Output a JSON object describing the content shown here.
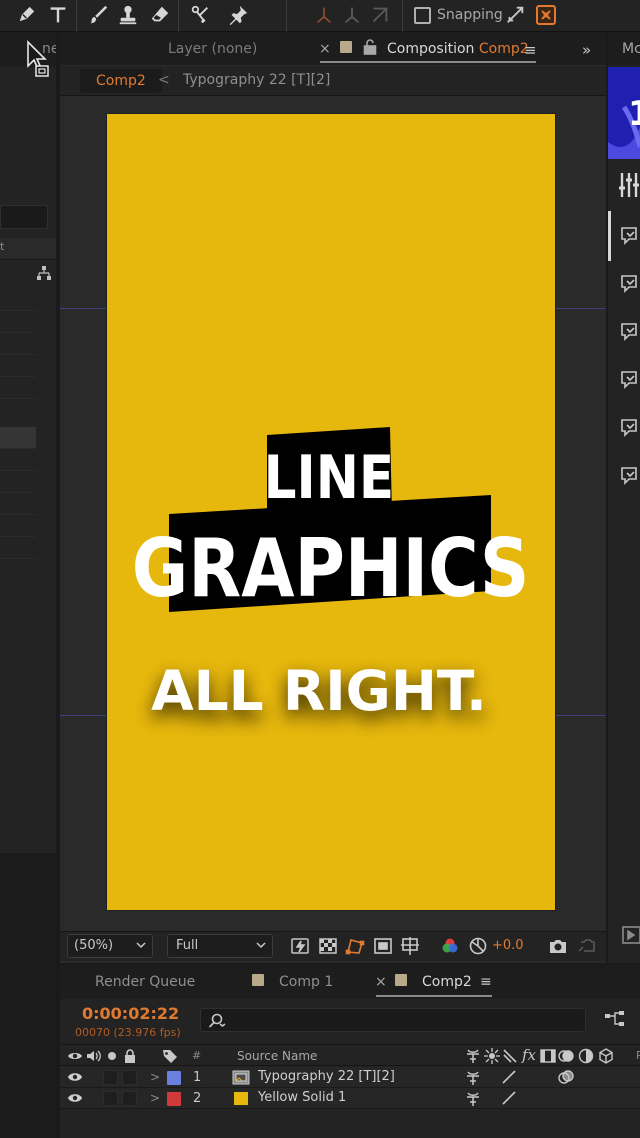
{
  "toolbar": {
    "snapping_label": "Snapping",
    "snapping_checked": false,
    "tools": [
      "pen-tool-icon",
      "type-tool-icon",
      "brush-tool-icon",
      "clone-stamp-icon",
      "eraser-icon",
      "roto-brush-icon",
      "puppet-pin-icon"
    ]
  },
  "left_panel": {
    "tab_label": "ne)"
  },
  "viewer": {
    "layer_tab": "Layer",
    "layer_tab_value": "(none)",
    "close_glyph": "×",
    "composition_tab_prefix": "Composition",
    "composition_name": "Comp2",
    "menu_glyph": "≡",
    "breadcrumb": {
      "active": "Comp2",
      "separator": "<",
      "item": "Typography 22 [T][2]"
    },
    "canvas": {
      "background_color": "#e6b70c",
      "title_line1": "LINE",
      "title_line2": "GRAPHICS",
      "subtitle": "ALL RIGHT."
    },
    "footer": {
      "zoom": "(50%)",
      "resolution": "Full",
      "exposure": "+0.0"
    }
  },
  "right_panel": {
    "tab_label": "Mc",
    "collapse_glyph": "»"
  },
  "timeline": {
    "tabs": [
      {
        "label": "Render Queue"
      },
      {
        "label": "Comp 1"
      },
      {
        "label": "Comp2"
      }
    ],
    "close_glyph": "×",
    "menu_glyph": "≡",
    "current_time": "0:00:02:22",
    "frame_info": "00070 (23.976 fps)",
    "columns": {
      "number": "#",
      "source_name": "Source Name",
      "fx": "fx",
      "parent_short": "P"
    },
    "layers": [
      {
        "number": "1",
        "name": "Typography 22 [T][2]",
        "label_color": "#6b7fe0",
        "type": "precomp"
      },
      {
        "number": "2",
        "name": "Yellow Solid 1",
        "label_color": "#d03a3a",
        "type": "solid",
        "solid_color": "#e6b70c"
      }
    ]
  }
}
